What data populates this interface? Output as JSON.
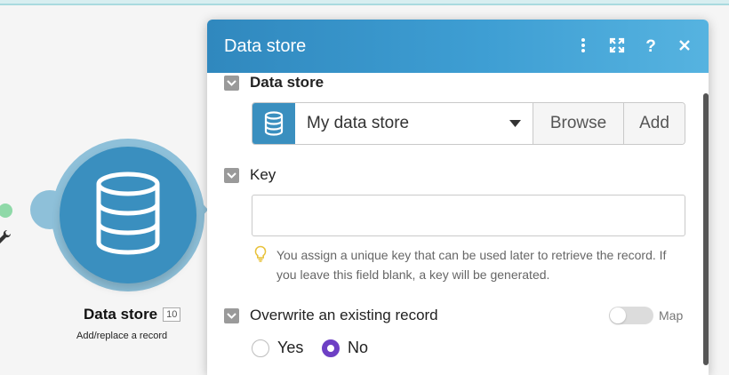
{
  "canvas": {
    "module": {
      "title": "Data store",
      "badge": "10",
      "subtitle": "Add/replace a record",
      "icon": "database-icon"
    },
    "wrench_icon": "wrench-icon"
  },
  "dialog": {
    "title": "Data store",
    "header_icons": [
      "more-vertical-icon",
      "expand-icon",
      "help-icon",
      "close-icon"
    ],
    "data_store_section": {
      "label": "Data store",
      "selected_value": "My data store",
      "browse_label": "Browse",
      "add_label": "Add"
    },
    "key_section": {
      "label": "Key",
      "value": "",
      "hint": "You assign a unique key that can be used later to retrieve the record. If you leave this field blank, a key will be generated."
    },
    "overwrite_section": {
      "label": "Overwrite an existing record",
      "map_label": "Map",
      "map_enabled": false,
      "options": [
        {
          "label": "Yes",
          "checked": false
        },
        {
          "label": "No",
          "checked": true
        }
      ]
    }
  },
  "colors": {
    "header_start": "#3088be",
    "header_end": "#56b3e0",
    "module_blue": "#3a8fbf",
    "radio_selected": "#6d3fc4"
  }
}
